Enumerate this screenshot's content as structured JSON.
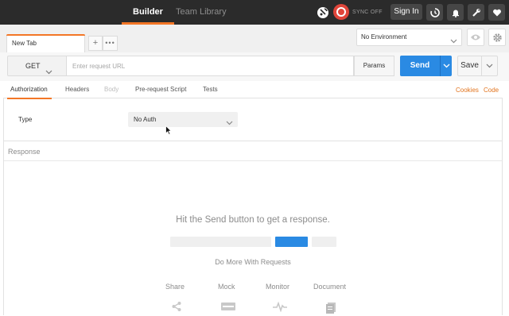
{
  "topbar": {
    "nav": {
      "builder": "Builder",
      "team_library": "Team Library"
    },
    "sync_label": "SYNC OFF",
    "signin_label": "Sign In"
  },
  "tabs": {
    "active_tab": "New Tab",
    "add_label": "+",
    "more_label": "•••"
  },
  "environment": {
    "selected": "No Environment"
  },
  "request": {
    "method": "GET",
    "url_value": "",
    "url_placeholder": "Enter request URL",
    "params_label": "Params",
    "send_label": "Send",
    "save_label": "Save"
  },
  "subtabs": {
    "items": [
      "Authorization",
      "Headers",
      "Body",
      "Pre-request Script",
      "Tests"
    ],
    "active": "Authorization",
    "links": {
      "cookies": "Cookies",
      "code": "Code"
    }
  },
  "auth": {
    "type_label": "Type",
    "type_value": "No Auth"
  },
  "response": {
    "label": "Response",
    "hint": "Hit the Send button to get a response.",
    "more_title": "Do More With Requests",
    "features": [
      "Share",
      "Mock",
      "Monitor",
      "Document"
    ]
  },
  "colors": {
    "accent": "#f37626",
    "primary_button": "#2a8ae3",
    "topbar": "#2b2b2b",
    "sync": "#e0453a"
  },
  "icons": [
    "satellite-icon",
    "sync-icon",
    "history-icon",
    "bell-icon",
    "wrench-icon",
    "heart-icon",
    "eye-icon",
    "gear-icon",
    "chevron-down-icon",
    "share-icon",
    "mock-server-icon",
    "monitor-icon",
    "document-icon",
    "mouse-cursor-icon"
  ]
}
